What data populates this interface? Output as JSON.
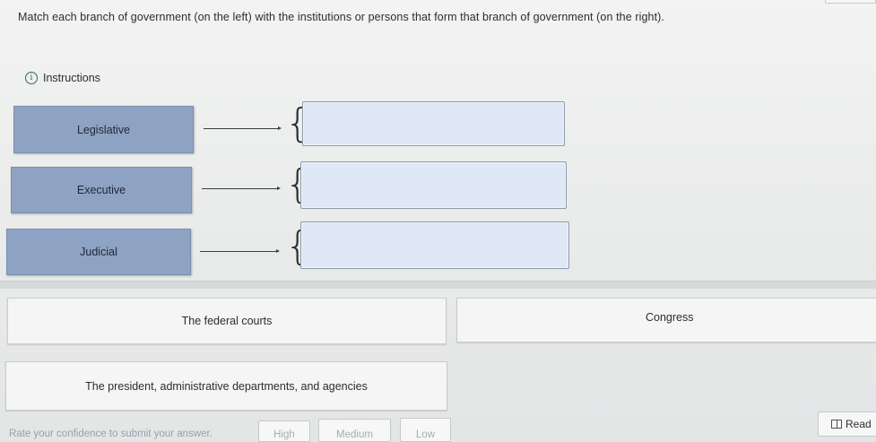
{
  "question": "Match each branch of government (on the left) with the institutions or persons that form that branch of government (on the right).",
  "instructions": {
    "label": "Instructions",
    "icon": "info-icon"
  },
  "branches": [
    {
      "label": "Legislative"
    },
    {
      "label": "Executive"
    },
    {
      "label": "Judicial"
    }
  ],
  "answer_tiles": [
    {
      "label": "The federal courts"
    },
    {
      "label": "Congress"
    },
    {
      "label": "The president, administrative departments, and agencies"
    }
  ],
  "footer": {
    "prompt": "Rate your confidence to submit your answer.",
    "confidence_options": [
      "High",
      "Medium",
      "Low"
    ],
    "read_label": "Read",
    "read_icon": "book-icon"
  },
  "colors": {
    "branch_fill": "#8ea3c3",
    "dropzone_fill": "#dfe8f5",
    "accent_green": "#2c6e4e"
  }
}
